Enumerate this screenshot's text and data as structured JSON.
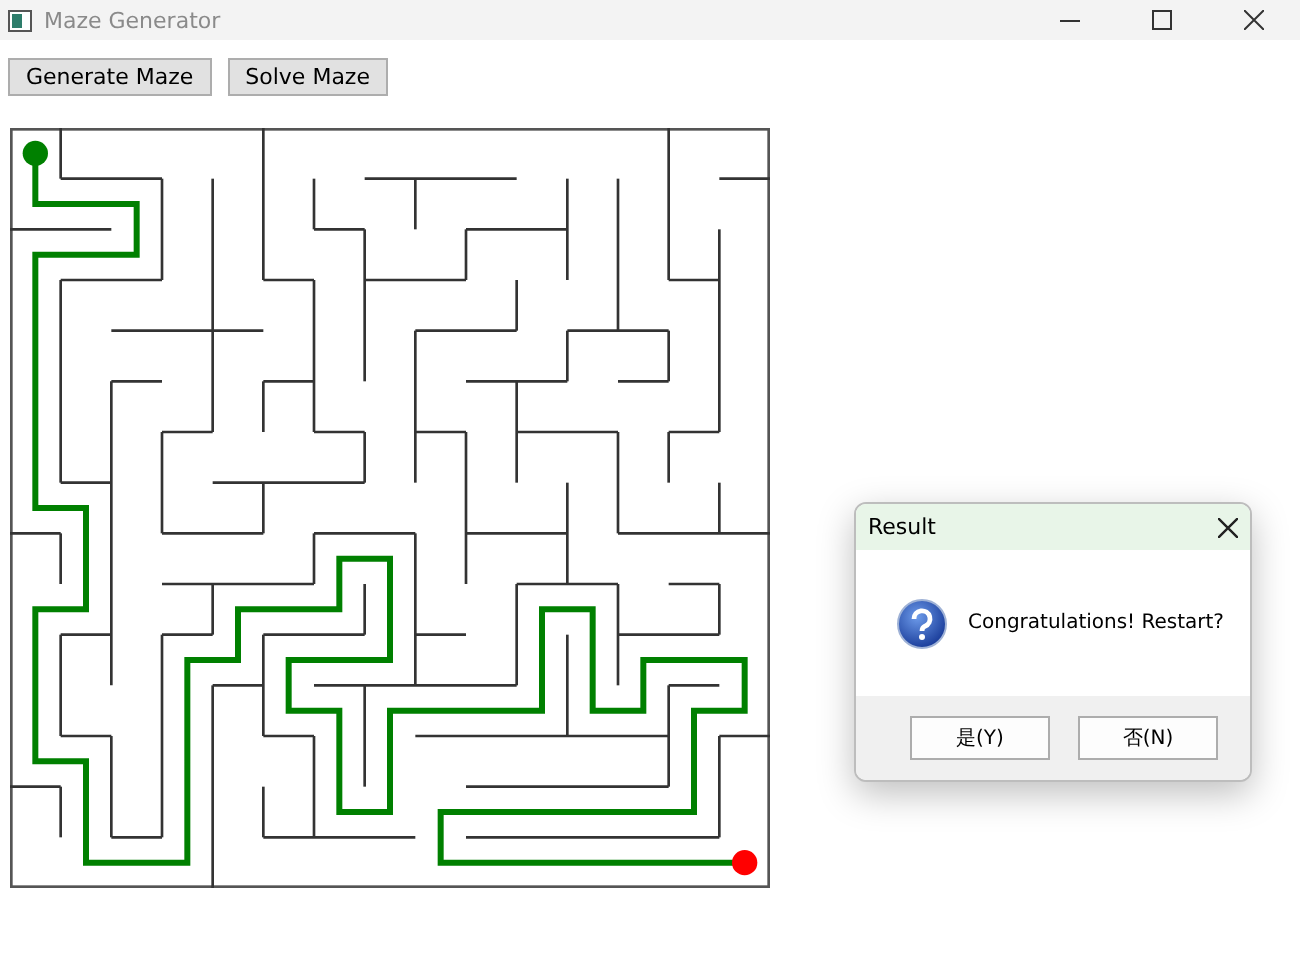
{
  "window": {
    "title": "Maze Generator"
  },
  "toolbar": {
    "buttons": [
      "Generate Maze",
      "Solve Maze"
    ]
  },
  "dialog": {
    "title": "Result",
    "message": "Congratulations! Restart?",
    "buttons": [
      "是(Y)",
      "否(N)"
    ]
  }
}
